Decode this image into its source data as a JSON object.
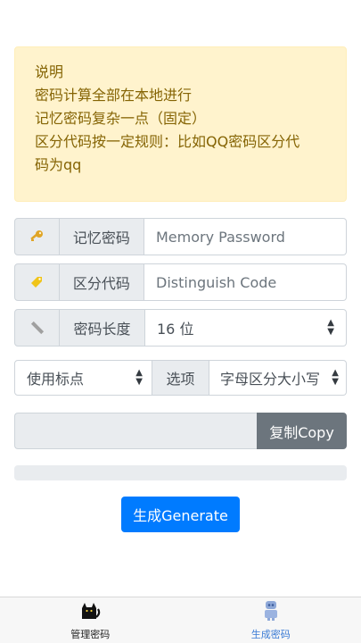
{
  "notice": {
    "lines": [
      "说明",
      "密码计算全部在本地进行",
      "记忆密码复杂一点（固定）",
      "区分代码按一定规则：比如QQ密码区分代",
      "码为qq"
    ]
  },
  "memory": {
    "icon": "key-icon",
    "label": "记忆密码",
    "placeholder": "Memory Password",
    "value": ""
  },
  "distinguish": {
    "icon": "tag-icon",
    "label": "区分代码",
    "placeholder": "Distinguish Code",
    "value": ""
  },
  "length": {
    "icon": "ruler-icon",
    "label": "密码长度",
    "selected": "16 位"
  },
  "punctuation": {
    "selected": "使用标点"
  },
  "options": {
    "label": "选项",
    "selected": "字母区分大小写"
  },
  "output": {
    "value": "",
    "copy_label": "复制Copy"
  },
  "generate_label": "生成Generate",
  "tabbar": {
    "manage": {
      "icon": "cat-icon",
      "label": "管理密码"
    },
    "generate": {
      "icon": "robot-icon",
      "label": "生成密码"
    }
  },
  "colors": {
    "primary": "#007bff",
    "secondary": "#6c757d",
    "notice_bg": "#fff3cd",
    "notice_text": "#856404"
  }
}
